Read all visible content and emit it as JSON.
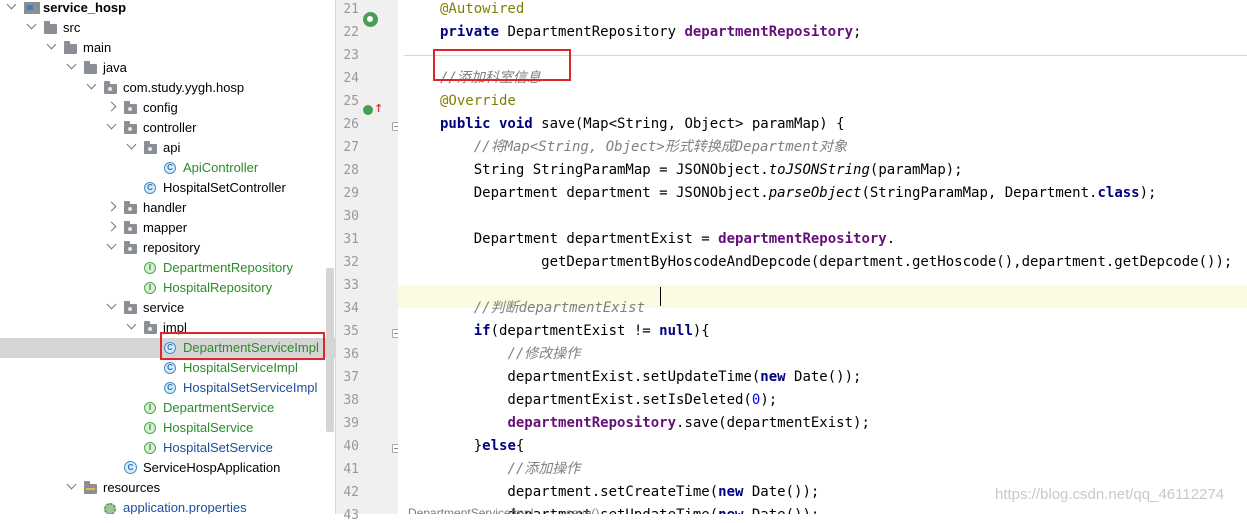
{
  "tree": {
    "items": [
      {
        "label": "service_hosp",
        "icon": "module-icon",
        "depth": 0,
        "arrow": "down",
        "bold": true
      },
      {
        "label": "src",
        "icon": "folder-icon",
        "depth": 1,
        "arrow": "down"
      },
      {
        "label": "main",
        "icon": "folder-icon",
        "depth": 2,
        "arrow": "down"
      },
      {
        "label": "java",
        "icon": "source-folder-icon",
        "depth": 3,
        "arrow": "down"
      },
      {
        "label": "com.study.yygh.hosp",
        "icon": "package-icon",
        "depth": 4,
        "arrow": "down"
      },
      {
        "label": "config",
        "icon": "package-icon",
        "depth": 5,
        "arrow": "right"
      },
      {
        "label": "controller",
        "icon": "package-icon",
        "depth": 5,
        "arrow": "down"
      },
      {
        "label": "api",
        "icon": "package-icon",
        "depth": 6,
        "arrow": "down"
      },
      {
        "label": "ApiController",
        "icon": "class-icon",
        "depth": 7,
        "color": "green"
      },
      {
        "label": "HospitalSetController",
        "icon": "class-icon",
        "depth": 6
      },
      {
        "label": "handler",
        "icon": "package-icon",
        "depth": 5,
        "arrow": "right"
      },
      {
        "label": "mapper",
        "icon": "package-icon",
        "depth": 5,
        "arrow": "right"
      },
      {
        "label": "repository",
        "icon": "package-icon",
        "depth": 5,
        "arrow": "down"
      },
      {
        "label": "DepartmentRepository",
        "icon": "interface-icon",
        "depth": 6,
        "color": "green"
      },
      {
        "label": "HospitalRepository",
        "icon": "interface-icon",
        "depth": 6,
        "color": "green"
      },
      {
        "label": "service",
        "icon": "package-icon",
        "depth": 5,
        "arrow": "down"
      },
      {
        "label": "impl",
        "icon": "package-icon",
        "depth": 6,
        "arrow": "down"
      },
      {
        "label": "DepartmentServiceImpl",
        "icon": "class-icon",
        "depth": 7,
        "color": "green",
        "selected": true
      },
      {
        "label": "HospitalServiceImpl",
        "icon": "class-icon",
        "depth": 7,
        "color": "green"
      },
      {
        "label": "HospitalSetServiceImpl",
        "icon": "class-icon",
        "depth": 7,
        "color": "blue"
      },
      {
        "label": "DepartmentService",
        "icon": "interface-icon",
        "depth": 6,
        "color": "green"
      },
      {
        "label": "HospitalService",
        "icon": "interface-icon",
        "depth": 6,
        "color": "green"
      },
      {
        "label": "HospitalSetService",
        "icon": "interface-icon",
        "depth": 6,
        "color": "blue"
      },
      {
        "label": "ServiceHospApplication",
        "icon": "spring-boot-class-icon",
        "depth": 5
      },
      {
        "label": "resources",
        "icon": "resources-folder-icon",
        "depth": 3,
        "arrow": "down"
      },
      {
        "label": "application.properties",
        "icon": "properties-file-icon",
        "depth": 4,
        "color": "blue"
      }
    ]
  },
  "gutter": {
    "line_numbers": [
      "21",
      "22",
      "23",
      "24",
      "25",
      "26",
      "27",
      "28",
      "29",
      "30",
      "31",
      "32",
      "33",
      "34",
      "35",
      "36",
      "37",
      "38",
      "39",
      "40",
      "41",
      "42",
      "43"
    ]
  },
  "editor": {
    "lines": [
      [
        {
          "t": "@Autowired",
          "c": "an"
        }
      ],
      [
        {
          "t": "private ",
          "c": "kw"
        },
        {
          "t": "DepartmentRepository "
        },
        {
          "t": "departmentRepository",
          "c": "fld"
        },
        {
          "t": ";"
        }
      ],
      [],
      [
        {
          "t": "//添加科室信息",
          "c": "cm"
        }
      ],
      [
        {
          "t": "@Override",
          "c": "an"
        }
      ],
      [
        {
          "t": "public void ",
          "c": "kw"
        },
        {
          "t": "save(Map<String, Object> paramMap) {"
        }
      ],
      [
        {
          "t": "    "
        },
        {
          "t": "//将Map<String, Object>形式转换成Department对象",
          "c": "cm"
        }
      ],
      [
        {
          "t": "    String StringParamMap = JSONObject."
        },
        {
          "t": "toJSONString",
          "c": "st"
        },
        {
          "t": "(paramMap);"
        }
      ],
      [
        {
          "t": "    Department department = JSONObject."
        },
        {
          "t": "parseObject",
          "c": "st"
        },
        {
          "t": "(StringParamMap, Department."
        },
        {
          "t": "class",
          "c": "kw"
        },
        {
          "t": ");"
        }
      ],
      [],
      [
        {
          "t": "    Department departmentExist = "
        },
        {
          "t": "departmentRepository",
          "c": "fld"
        },
        {
          "t": "."
        }
      ],
      [
        {
          "t": "            getDepartmentByHoscodeAndDepcode(department.getHoscode(),department.getDepcode());"
        }
      ],
      [],
      [
        {
          "t": "    "
        },
        {
          "t": "//判断departmentExist",
          "c": "cm"
        }
      ],
      [
        {
          "t": "    "
        },
        {
          "t": "if",
          "c": "kw"
        },
        {
          "t": "(departmentExist != "
        },
        {
          "t": "null",
          "c": "kw"
        },
        {
          "t": "){"
        }
      ],
      [
        {
          "t": "        "
        },
        {
          "t": "//修改操作",
          "c": "cm"
        }
      ],
      [
        {
          "t": "        departmentExist.setUpdateTime("
        },
        {
          "t": "new ",
          "c": "kw"
        },
        {
          "t": "Date());"
        }
      ],
      [
        {
          "t": "        departmentExist.setIsDeleted("
        },
        {
          "t": "0",
          "c": "num"
        },
        {
          "t": ");"
        }
      ],
      [
        {
          "t": "        "
        },
        {
          "t": "departmentRepository",
          "c": "fld"
        },
        {
          "t": ".save(departmentExist);"
        }
      ],
      [
        {
          "t": "    }"
        },
        {
          "t": "else",
          "c": "kw"
        },
        {
          "t": "{"
        }
      ],
      [
        {
          "t": "        "
        },
        {
          "t": "//添加操作",
          "c": "cm"
        }
      ],
      [
        {
          "t": "        department.setCreateTime("
        },
        {
          "t": "new ",
          "c": "kw"
        },
        {
          "t": "Date());"
        }
      ],
      [
        {
          "t": "        department.setUpdateTime("
        },
        {
          "t": "new ",
          "c": "kw"
        },
        {
          "t": "Date());"
        }
      ]
    ]
  },
  "breadcrumb": {
    "class_name": "DepartmentServiceImpl",
    "separator": "›",
    "method": "save()"
  },
  "watermark": "https://blog.csdn.net/qq_46112274",
  "colors": {
    "highlight_box": "#e0262a",
    "selected_row": "#d5d5d5",
    "current_line": "#fcfae0",
    "keyword": "#000080",
    "field": "#660e7a",
    "comment": "#808080",
    "annotation": "#808000"
  }
}
